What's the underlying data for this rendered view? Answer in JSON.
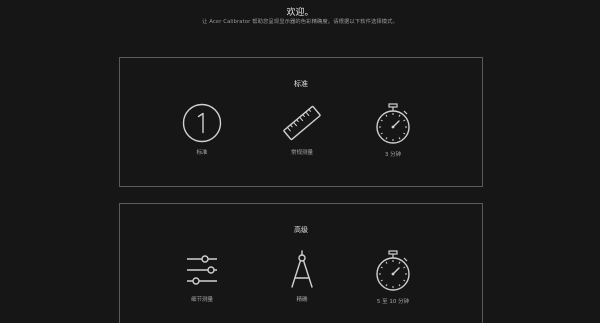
{
  "header": {
    "title": "欢迎。",
    "subtitle": "让 Acer Calibrator 帮助您呈现显示器的色彩精确度。请根据以下软件选择模式。"
  },
  "panels": [
    {
      "title": "标准",
      "options": [
        {
          "label": "标准",
          "icon": "number-one-circle-icon"
        },
        {
          "label": "常规测量",
          "icon": "ruler-icon"
        },
        {
          "label": "3 分钟",
          "icon": "stopwatch-icon"
        }
      ]
    },
    {
      "title": "高级",
      "options": [
        {
          "label": "细节测量",
          "icon": "sliders-icon"
        },
        {
          "label": "精确",
          "icon": "compass-icon"
        },
        {
          "label": "5 至 10 分钟",
          "icon": "stopwatch-icon"
        }
      ]
    }
  ],
  "colors": {
    "background": "#161616",
    "panel_border": "#5a5a5a",
    "icon_stroke": "#d0d0d0",
    "text_primary": "#e6e6e6",
    "text_secondary": "#a8a8a8"
  }
}
